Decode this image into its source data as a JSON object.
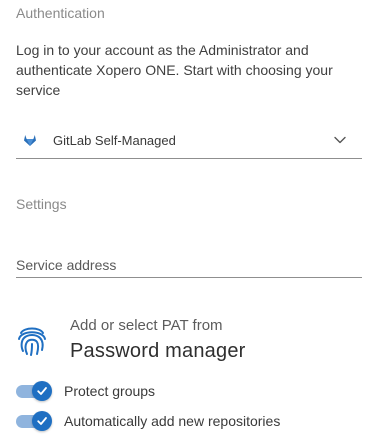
{
  "authentication": {
    "section_title": "Authentication",
    "intro": "Log in to your account as the Administrator and authenticate Xopero ONE. Start with choosing your service",
    "service_select": {
      "selected": "GitLab Self-Managed",
      "logo_icon": "gitlab-icon",
      "chevron_icon": "chevron-down-icon"
    }
  },
  "settings": {
    "section_title": "Settings",
    "service_address_placeholder": "Service address",
    "pat": {
      "icon": "fingerprint-icon",
      "line1": "Add or select PAT from",
      "line2": "Password manager"
    },
    "toggles": [
      {
        "label": "Protect groups",
        "checked": true
      },
      {
        "label": "Automatically add new repositories",
        "checked": true
      }
    ]
  },
  "colors": {
    "accent": "#1f6fc2",
    "accent_track": "#8fb4de",
    "gitlab": "#2a6fb8"
  }
}
